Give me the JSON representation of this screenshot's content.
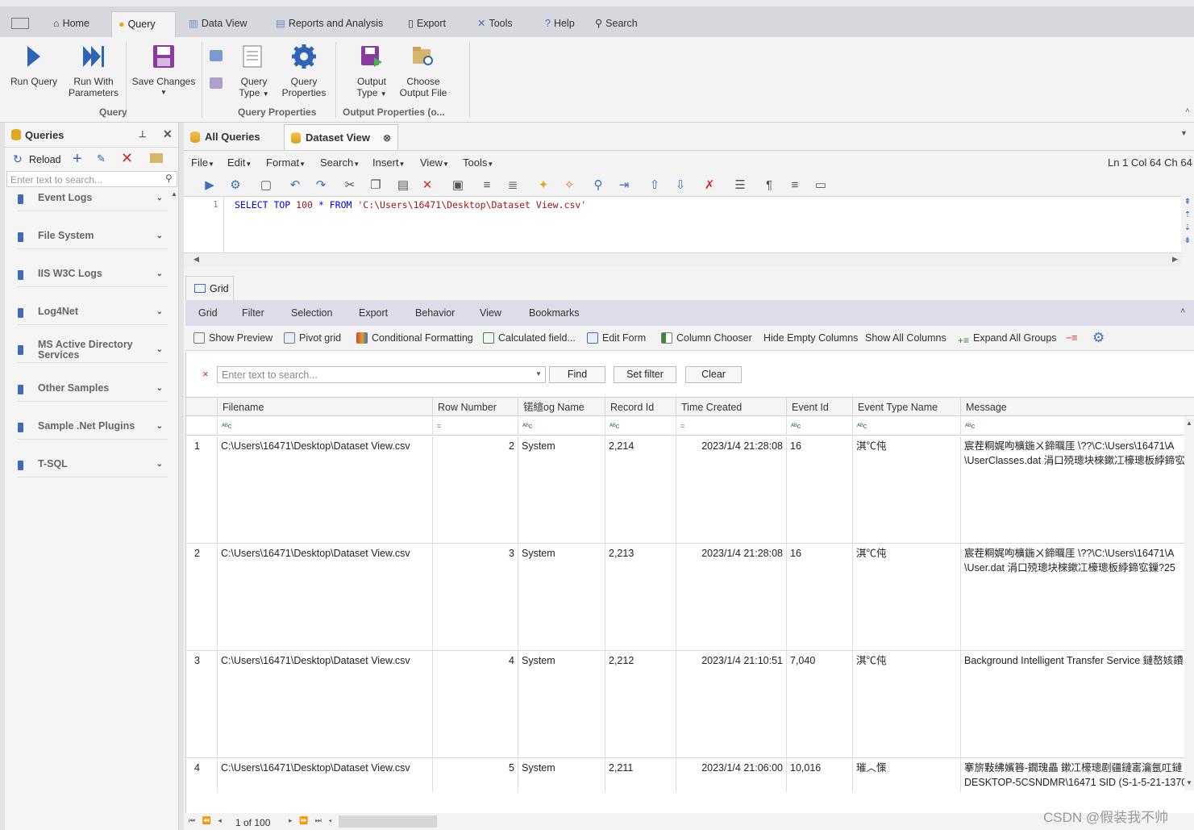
{
  "menubar": {
    "tabs": [
      {
        "label": "Home",
        "icon": "home-icon"
      },
      {
        "label": "Query",
        "icon": "database-icon"
      },
      {
        "label": "Data View",
        "icon": "chart-icon"
      },
      {
        "label": "Reports and Analysis",
        "icon": "report-icon"
      },
      {
        "label": "Export",
        "icon": "export-icon"
      },
      {
        "label": "Tools",
        "icon": "tools-icon"
      },
      {
        "label": "Help",
        "icon": "help-icon"
      },
      {
        "label": "Search",
        "icon": "search-icon"
      }
    ]
  },
  "ribbon": {
    "run_query": "Run Query",
    "run_with_params_1": "Run With",
    "run_with_params_2": "Parameters",
    "save_changes": "Save Changes",
    "query_type_1": "Query",
    "query_type_2": "Type",
    "query_props_1": "Query",
    "query_props_2": "Properties",
    "output_type_1": "Output",
    "output_type_2": "Type",
    "choose_output_1": "Choose",
    "choose_output_2": "Output File",
    "group_query": "Query",
    "group_query_props": "Query Properties",
    "group_output_props": "Output Properties (o..."
  },
  "left_panel": {
    "title": "Queries",
    "reload": "Reload",
    "search_placeholder": "Enter text to search...",
    "items": [
      {
        "label": "Event Logs"
      },
      {
        "label": "File System"
      },
      {
        "label": "IIS W3C Logs"
      },
      {
        "label": "Log4Net"
      },
      {
        "label": "MS Active Directory Services"
      },
      {
        "label": "Other Samples"
      },
      {
        "label": "Sample .Net Plugins"
      },
      {
        "label": "T-SQL"
      }
    ]
  },
  "doc_tabs": {
    "all_queries": "All Queries",
    "dataset_view": "Dataset View"
  },
  "editor_menu": {
    "items": [
      "File",
      "Edit",
      "Format",
      "Search",
      "Insert",
      "View",
      "Tools"
    ],
    "status": "Ln 1  Col 64  Ch 64"
  },
  "editor": {
    "line_number": "1",
    "sql_select": "SELECT TOP ",
    "sql_num": "100",
    "sql_mid": " * FROM ",
    "sql_path": "'C:\\Users\\16471\\Desktop\\Dataset View.csv'"
  },
  "grid_panel": {
    "tab": "Grid",
    "subtabs": [
      "Grid",
      "Filter",
      "Selection",
      "Export",
      "Behavior",
      "View",
      "Bookmarks"
    ],
    "tools": {
      "show_preview": "Show Preview",
      "pivot_grid": "Pivot grid",
      "conditional_formatting": "Conditional Formatting",
      "calculated_field": "Calculated field...",
      "edit_form": "Edit Form",
      "column_chooser": "Column Chooser",
      "hide_empty": "Hide Empty Columns",
      "show_all": "Show All Columns",
      "expand_all": "Expand All Groups"
    },
    "search_placeholder": "Enter text to search...",
    "find": "Find",
    "set_filter": "Set filter",
    "clear": "Clear"
  },
  "grid": {
    "columns": [
      "Filename",
      "Row Number",
      "锘縇og Name",
      "Record Id",
      "Time Created",
      "Event Id",
      "Event Type Name",
      "Message"
    ],
    "filter_marks": [
      "ᴬᴮc",
      "=",
      "ᴬᴮc",
      "ᴬᴮc",
      "=",
      "ᴬᴮc",
      "ᴬᴮc",
      "ᴬᴮc"
    ],
    "rows": [
      {
        "idx": "1",
        "filename": "C:\\Users\\16471\\Desktop\\Dataset View.csv",
        "rownum": "2",
        "log": "System",
        "record": "2,214",
        "time": "2023/1/4 21:28:08",
        "event": "16",
        "type": "淇℃伅",
        "msg1": "宸茬粡娓呴櫎鍦ㄨ鍗曞厓 \\??\\C:\\Users\\16471\\A",
        "msg2": "\\UserClasses.dat 涓口殑璁块棶鏉冮檺璁板綍鍗宖"
      },
      {
        "idx": "2",
        "filename": "C:\\Users\\16471\\Desktop\\Dataset View.csv",
        "rownum": "3",
        "log": "System",
        "record": "2,213",
        "time": "2023/1/4 21:28:08",
        "event": "16",
        "type": "淇℃伅",
        "msg1": "宸茬粡娓呴櫎鍦ㄨ鍗曞厓 \\??\\C:\\Users\\16471\\A",
        "msg2": "\\User.dat 涓口殑璁块棶鏉冮檺璁板綍鍗宖鏁?25"
      },
      {
        "idx": "3",
        "filename": "C:\\Users\\16471\\Desktop\\Dataset View.csv",
        "rownum": "4",
        "log": "System",
        "record": "2,212",
        "time": "2023/1/4 21:10:51",
        "event": "7,040",
        "type": "淇℃伅",
        "msg1": "Background Intelligent Transfer Service 鏈嶅姟鐨",
        "msg2": ""
      },
      {
        "idx": "4",
        "filename": "C:\\Users\\16471\\Desktop\\Dataset View.csv",
        "rownum": "5",
        "log": "System",
        "record": "2,211",
        "time": "2023/1/4 21:06:00",
        "event": "10,016",
        "type": "璀︿憡",
        "msg1": "搴旂敤绋嬪簭-鐗瑰畾 鏉冮檺璁剧疆鏈寚瀹氬叿鏈",
        "msg2": "DESKTOP-5CSNDMR\\16471 SID (S-1-5-21-13700"
      }
    ]
  },
  "pager": {
    "text": "1 of 100"
  },
  "watermark": "CSDN @假装我不帅"
}
